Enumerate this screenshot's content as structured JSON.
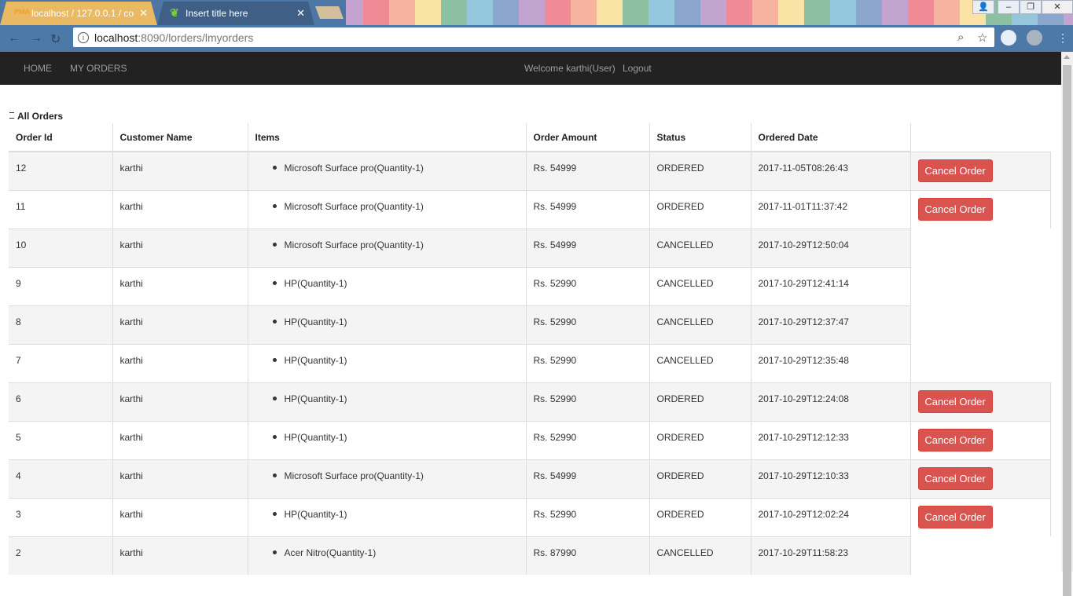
{
  "browser": {
    "tabs": [
      {
        "title": "localhost / 127.0.0.1 / co",
        "icon": "PMA"
      },
      {
        "title": "Insert title here",
        "icon": "leaf"
      }
    ],
    "url_host": "localhost",
    "url_rest": ":8090/lorders/lmyorders"
  },
  "navbar": {
    "home": "HOME",
    "my_orders": "MY ORDERS",
    "welcome": "Welcome karthi(User)",
    "logout": "Logout"
  },
  "page": {
    "caption": "All Orders",
    "columns": [
      "Order Id",
      "Customer Name",
      "Items",
      "Order Amount",
      "Status",
      "Ordered Date"
    ],
    "cancel_label": "Cancel Order",
    "orders": [
      {
        "id": "12",
        "customer": "karthi",
        "item": "Microsoft Surface pro(Quantity-1)",
        "amount": "Rs. 54999",
        "status": "ORDERED",
        "date": "2017-11-05T08:26:43"
      },
      {
        "id": "11",
        "customer": "karthi",
        "item": "Microsoft Surface pro(Quantity-1)",
        "amount": "Rs. 54999",
        "status": "ORDERED",
        "date": "2017-11-01T11:37:42"
      },
      {
        "id": "10",
        "customer": "karthi",
        "item": "Microsoft Surface pro(Quantity-1)",
        "amount": "Rs. 54999",
        "status": "CANCELLED",
        "date": "2017-10-29T12:50:04"
      },
      {
        "id": "9",
        "customer": "karthi",
        "item": "HP(Quantity-1)",
        "amount": "Rs. 52990",
        "status": "CANCELLED",
        "date": "2017-10-29T12:41:14"
      },
      {
        "id": "8",
        "customer": "karthi",
        "item": "HP(Quantity-1)",
        "amount": "Rs. 52990",
        "status": "CANCELLED",
        "date": "2017-10-29T12:37:47"
      },
      {
        "id": "7",
        "customer": "karthi",
        "item": "HP(Quantity-1)",
        "amount": "Rs. 52990",
        "status": "CANCELLED",
        "date": "2017-10-29T12:35:48"
      },
      {
        "id": "6",
        "customer": "karthi",
        "item": "HP(Quantity-1)",
        "amount": "Rs. 52990",
        "status": "ORDERED",
        "date": "2017-10-29T12:24:08"
      },
      {
        "id": "5",
        "customer": "karthi",
        "item": "HP(Quantity-1)",
        "amount": "Rs. 52990",
        "status": "ORDERED",
        "date": "2017-10-29T12:12:33"
      },
      {
        "id": "4",
        "customer": "karthi",
        "item": "Microsoft Surface pro(Quantity-1)",
        "amount": "Rs. 54999",
        "status": "ORDERED",
        "date": "2017-10-29T12:10:33"
      },
      {
        "id": "3",
        "customer": "karthi",
        "item": "HP(Quantity-1)",
        "amount": "Rs. 52990",
        "status": "ORDERED",
        "date": "2017-10-29T12:02:24"
      },
      {
        "id": "2",
        "customer": "karthi",
        "item": "Acer Nitro(Quantity-1)",
        "amount": "Rs. 87990",
        "status": "CANCELLED",
        "date": "2017-10-29T11:58:23"
      }
    ]
  },
  "colors": {
    "navbar_bg": "#222222",
    "cancel_button": "#d9534f",
    "stripe": "#f4f4f4"
  }
}
